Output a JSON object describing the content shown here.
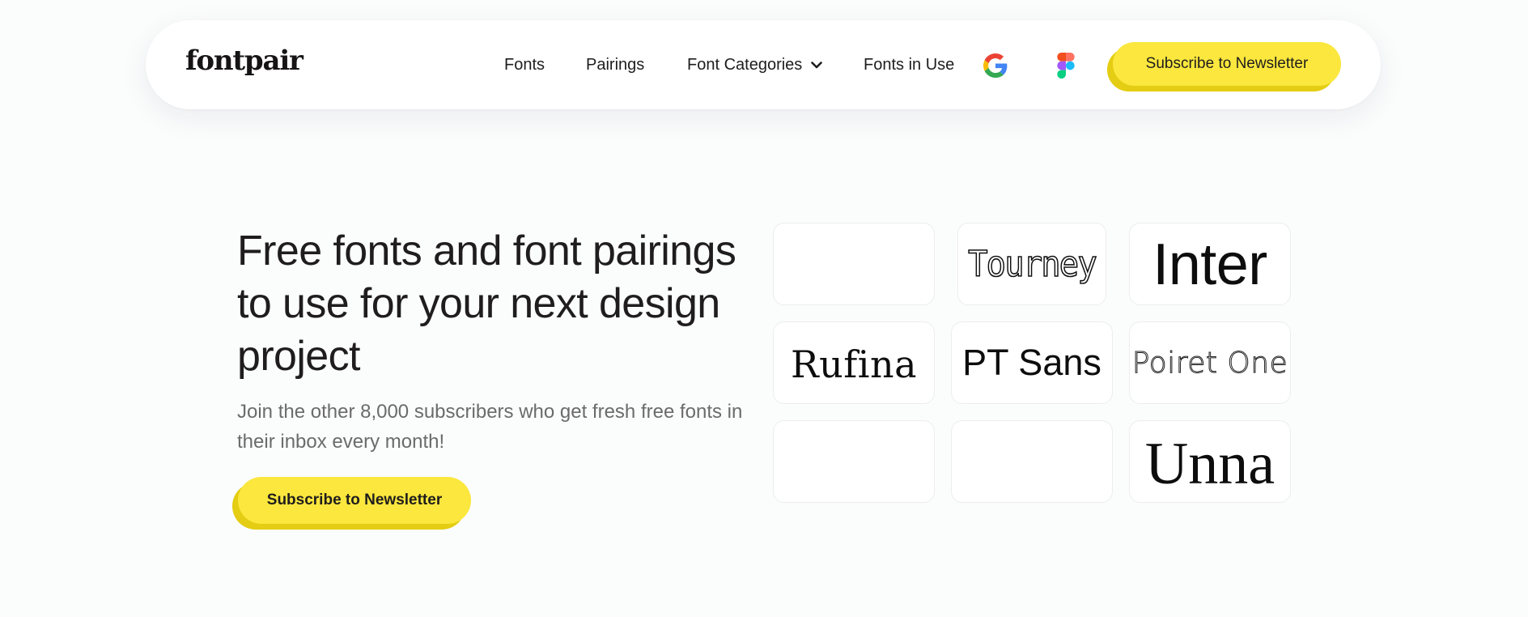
{
  "nav": {
    "logo": "fontpair",
    "links": [
      {
        "label": "Fonts"
      },
      {
        "label": "Pairings"
      },
      {
        "label": "Font Categories"
      },
      {
        "label": "Fonts in Use"
      }
    ],
    "icons": [
      "google-icon",
      "figma-icon"
    ],
    "subscribe_label": "Subscribe to Newsletter"
  },
  "hero": {
    "title": "Free fonts and font pairings to use for your next design project",
    "subtitle": "Join the other 8,000 subscribers who get fresh free fonts in their inbox every month!",
    "subscribe_label": "Subscribe to Newsletter"
  },
  "tiles": [
    {
      "label": ""
    },
    {
      "label": "Tourney"
    },
    {
      "label": "Inter"
    },
    {
      "label": "Rufina"
    },
    {
      "label": "PT Sans"
    },
    {
      "label": "Poiret One"
    },
    {
      "label": ""
    },
    {
      "label": ""
    },
    {
      "label": "Unna"
    }
  ],
  "colors": {
    "accent": "#fbe73d",
    "accent_shadow": "#e4cd12",
    "page_background": "#fbfcfc",
    "text": "#1f1d1d",
    "muted_text": "#6b6b6b"
  }
}
